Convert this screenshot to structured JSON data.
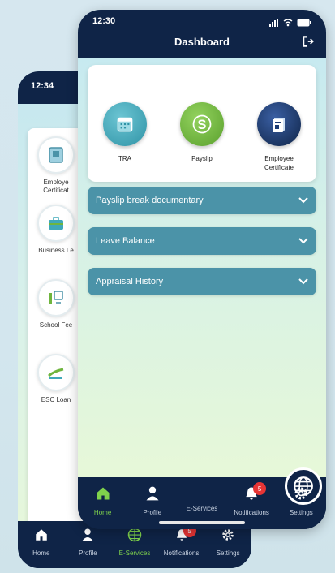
{
  "back_phone": {
    "status_time": "12:34",
    "services": [
      {
        "label": "Employe",
        "label2": "Certificat",
        "icon": "certificate-icon"
      },
      {
        "label": "Business Le",
        "label2": "",
        "icon": "briefcase-icon"
      },
      {
        "label": "School Fee",
        "label2": "",
        "icon": "school-fee-icon"
      },
      {
        "label": "ESC Loan",
        "label2": "",
        "icon": "loan-icon"
      }
    ],
    "nav": [
      {
        "label": "Home",
        "icon": "home-icon"
      },
      {
        "label": "Profile",
        "icon": "profile-icon"
      },
      {
        "label": "E-Services",
        "icon": "globe-icon",
        "active": true
      },
      {
        "label": "Notifications",
        "icon": "bell-icon",
        "badge": "5"
      },
      {
        "label": "Settings",
        "icon": "gear-icon"
      }
    ]
  },
  "front_phone": {
    "status_time": "12:30",
    "title": "Dashboard",
    "quick_actions": [
      {
        "label": "TRA",
        "icon": "calendar-icon",
        "color": "#3fa8b9"
      },
      {
        "label": "Payslip",
        "icon": "dollar-icon",
        "color": "#6fb53e"
      },
      {
        "label": "Employee",
        "label2": "Certificate",
        "icon": "certificate-icon",
        "color": "#1b3a73"
      }
    ],
    "accordions": [
      {
        "label": "Payslip break documentary"
      },
      {
        "label": "Leave Balance"
      },
      {
        "label": "Appraisal History"
      }
    ],
    "nav": [
      {
        "label": "Home",
        "icon": "home-icon",
        "active": true
      },
      {
        "label": "Profile",
        "icon": "profile-icon"
      },
      {
        "label": "E-Services",
        "icon": "globe-icon"
      },
      {
        "label": "Notifications",
        "icon": "bell-icon",
        "badge": "5"
      },
      {
        "label": "Settings",
        "icon": "gear-icon"
      }
    ]
  },
  "colors": {
    "navy": "#0f2447",
    "accordion": "#4b93a8",
    "active_green": "#7fd24c",
    "badge_red": "#e73535"
  }
}
